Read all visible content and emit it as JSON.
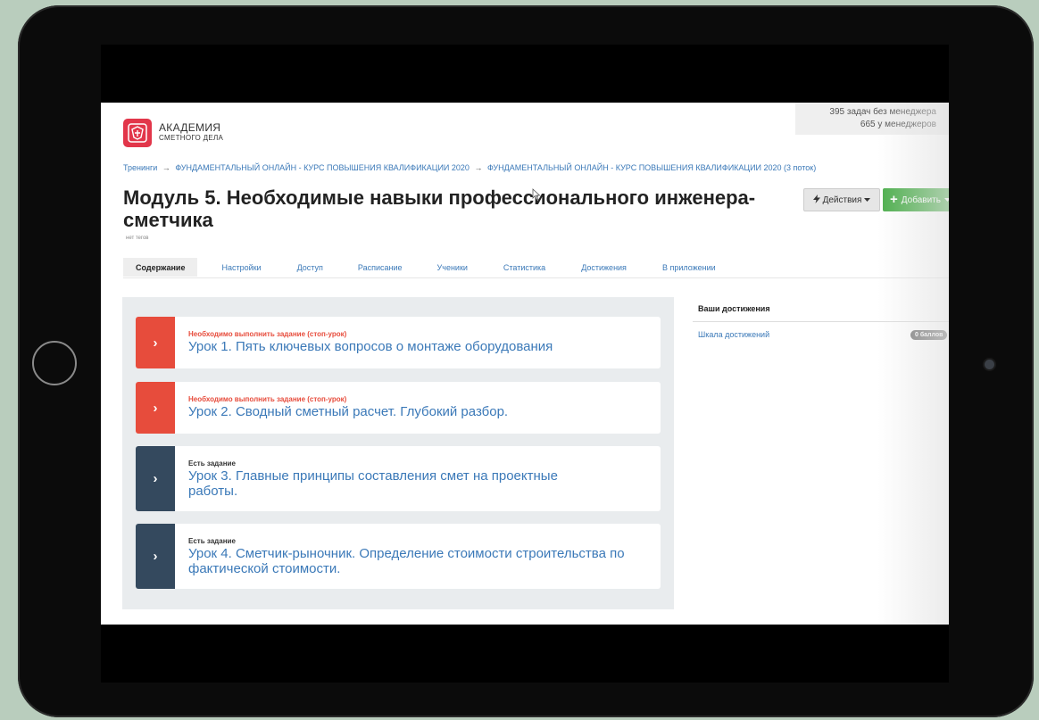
{
  "logo": {
    "line1": "АКАДЕМИЯ",
    "line2": "СМЕТНОГО ДЕЛА"
  },
  "stats": {
    "unassigned": "395 задач без менеджера",
    "assigned": "665 у менеджеров"
  },
  "breadcrumb": [
    "Тренинги",
    "ФУНДАМЕНТАЛЬНЫЙ ОНЛАЙН - КУРС ПОВЫШЕНИЯ КВАЛИФИКАЦИИ 2020",
    "ФУНДАМЕНТАЛЬНЫЙ ОНЛАЙН - КУРС ПОВЫШЕНИЯ КВАЛИФИКАЦИИ 2020 (3 поток)"
  ],
  "breadcrumb_separator": "→",
  "title": "Модуль 5. Необходимые навыки профессионального инженера-сметчика",
  "tags": "нет тегов",
  "actions": {
    "actions_label": "Действия",
    "add_label": "Добавить",
    "actions_icon": "lightning-icon",
    "add_icon": "plus-icon",
    "caret_icon": "caret-down-icon"
  },
  "tabs": [
    {
      "label": "Содержание",
      "active": true
    },
    {
      "label": "Настройки",
      "active": false
    },
    {
      "label": "Доступ",
      "active": false
    },
    {
      "label": "Расписание",
      "active": false
    },
    {
      "label": "Ученики",
      "active": false
    },
    {
      "label": "Статистика",
      "active": false
    },
    {
      "label": "Достижения",
      "active": false
    },
    {
      "label": "В приложении",
      "active": false
    }
  ],
  "lessons": [
    {
      "status": "Необходимо выполнить задание (стоп-урок)",
      "title": "Урок 1. Пять ключевых вопросов о монтаже оборудования",
      "kind": "stop"
    },
    {
      "status": "Необходимо выполнить задание (стоп-урок)",
      "title": "Урок 2. Сводный сметный расчет. Глубокий разбор.",
      "kind": "stop"
    },
    {
      "status": "Есть задание",
      "title": "Урок 3. Главные принципы составления смет на проектные работы.",
      "kind": "task"
    },
    {
      "status": "Есть задание",
      "title": "Урок 4. Сметчик-рыночник. Определение стоимости строительства по фактической стоимости.",
      "kind": "task"
    }
  ],
  "lesson_arrow": "›",
  "achievements": {
    "header": "Ваши достижения",
    "link": "Шкала достижений",
    "badge": "0 баллов"
  },
  "colors": {
    "stop": "#e74c3c",
    "task": "#34495e",
    "link": "#3b79b8",
    "add": "#4cae4c",
    "brand": "#e2364a"
  }
}
